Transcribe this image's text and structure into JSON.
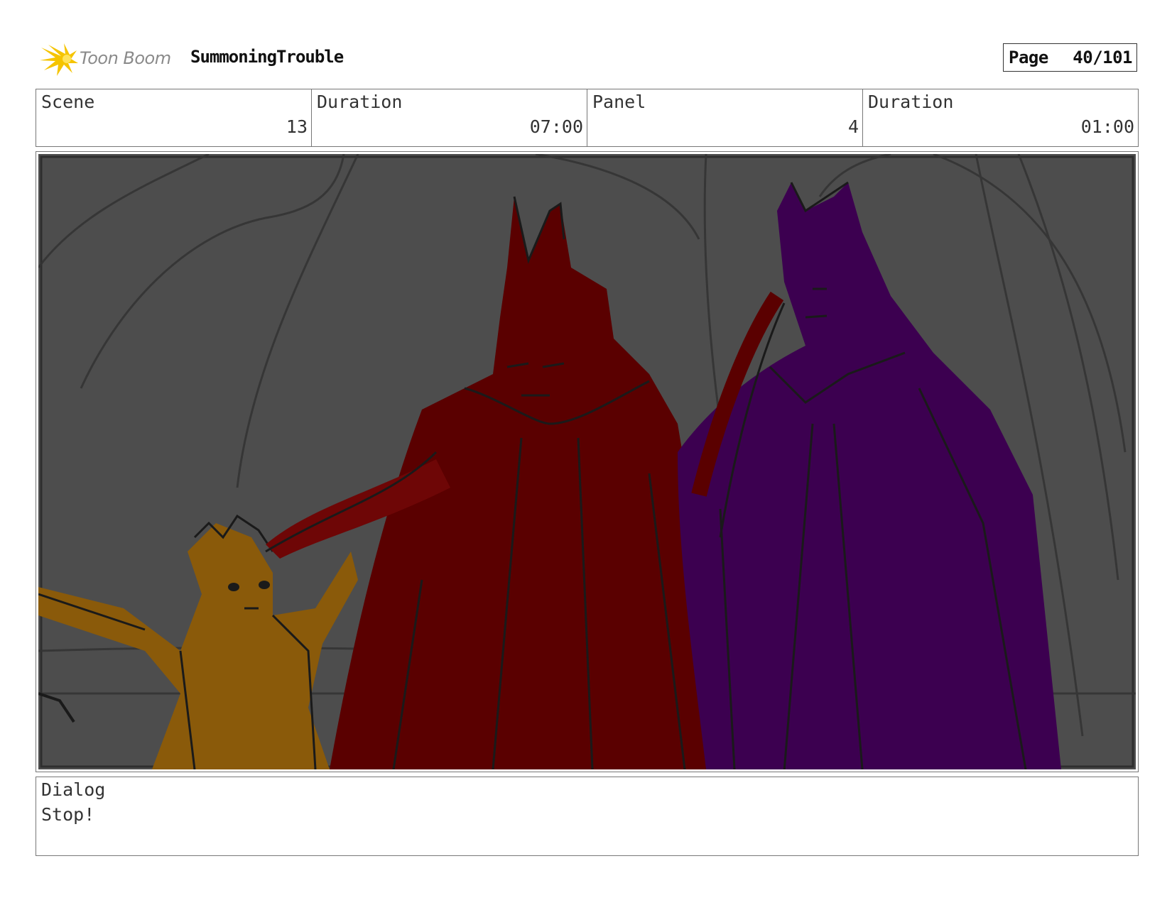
{
  "header": {
    "logo_text": "Toon Boom",
    "project_title": "SummoningTrouble",
    "page_label": "Page",
    "page_value": "40/101"
  },
  "info": {
    "scene_label": "Scene",
    "scene_value": "13",
    "scene_duration_label": "Duration",
    "scene_duration_value": "07:00",
    "panel_label": "Panel",
    "panel_value": "4",
    "panel_duration_label": "Duration",
    "panel_duration_value": "01:00"
  },
  "panel": {
    "background_color": "#4d4d4d",
    "characters": [
      {
        "name": "small-orange-character",
        "color": "#8a5a0a"
      },
      {
        "name": "red-caped-character",
        "color": "#5a0000"
      },
      {
        "name": "purple-caped-character",
        "color": "#3c0050"
      }
    ]
  },
  "dialog": {
    "label": "Dialog",
    "text": "Stop!"
  }
}
